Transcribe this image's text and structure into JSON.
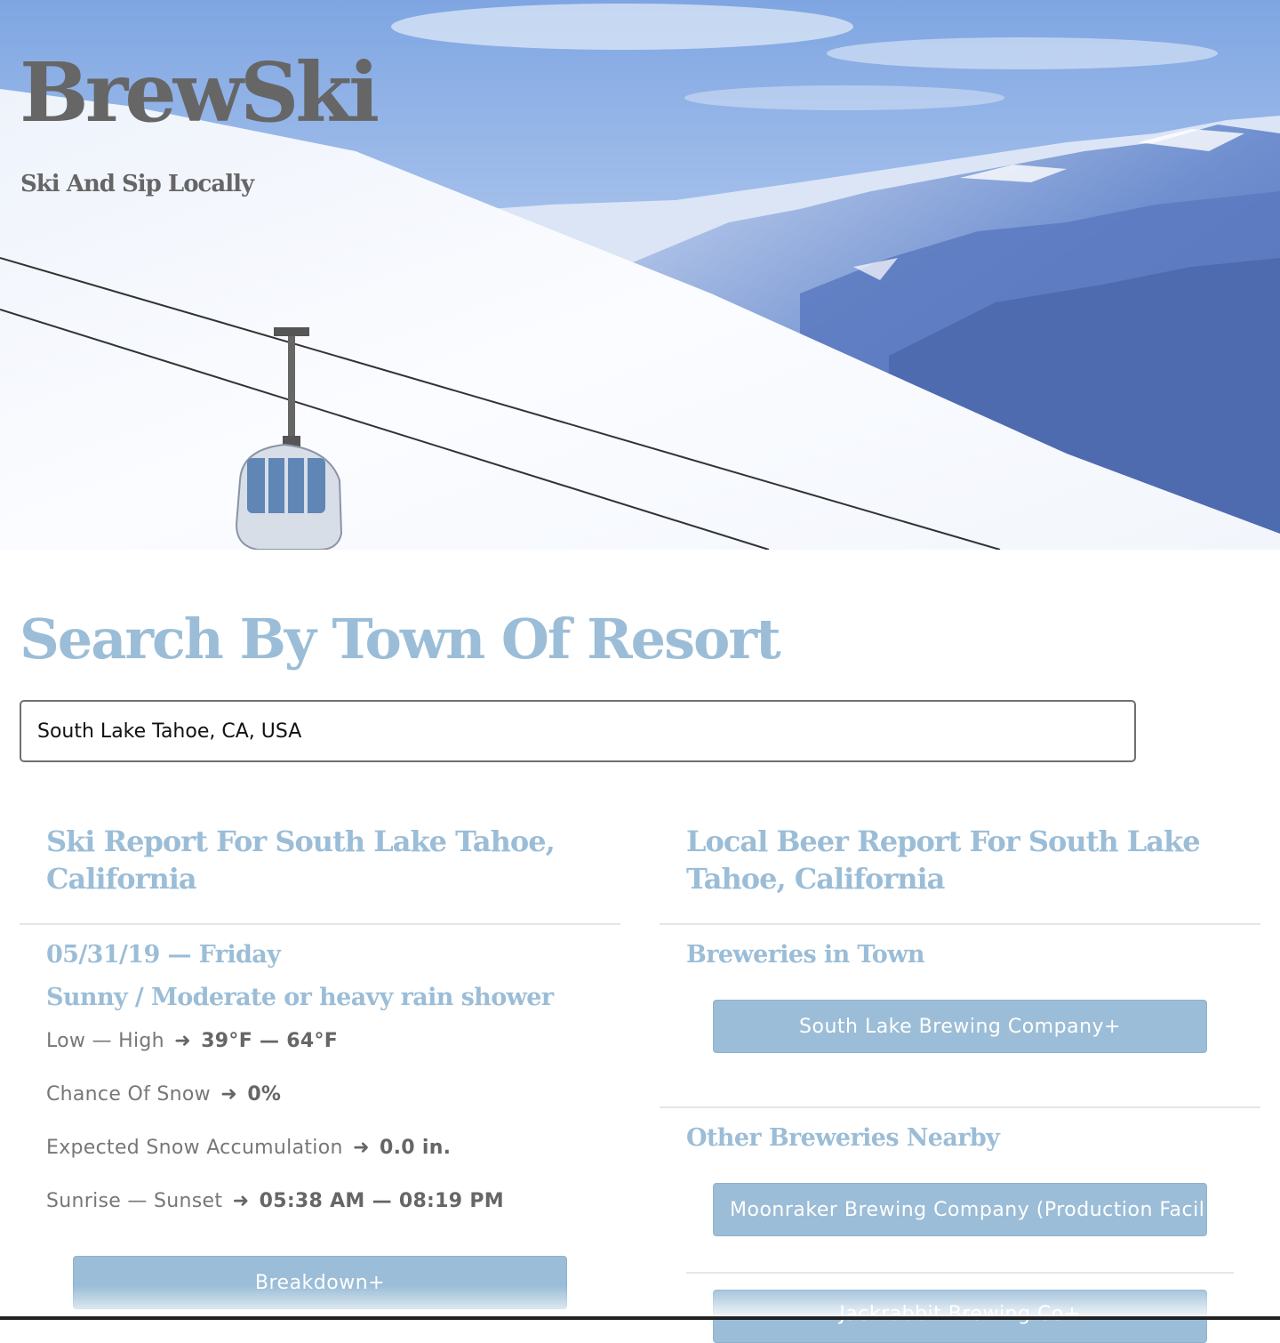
{
  "brand": {
    "name": "BrewSki",
    "tagline": "Ski And Sip Locally"
  },
  "search": {
    "title": "Search By Town Of Resort",
    "value": "South Lake Tahoe, CA, USA"
  },
  "ski_report": {
    "title": "Ski Report For South Lake Tahoe, California",
    "date": "05/31/19 — Friday",
    "conditions": "Sunny / Moderate or heavy rain shower",
    "temp_label": "Low — High",
    "temp_value": "39°F — 64°F",
    "snow_chance_label": "Chance Of Snow",
    "snow_chance_value": "0%",
    "accumulation_label": "Expected Snow Accumulation",
    "accumulation_value": "0.0 in.",
    "sun_label": "Sunrise — Sunset",
    "sun_value": "05:38 AM — 08:19 PM",
    "arrow": "➜",
    "breakdown_label": "Breakdown+"
  },
  "beer_report": {
    "title": "Local Beer Report For South Lake Tahoe, California",
    "in_town_title": "Breweries in Town",
    "in_town": [
      "South Lake Brewing Company+"
    ],
    "nearby_title": "Other Breweries Nearby",
    "nearby": [
      "Moonraker Brewing Company (Production Facility",
      "Jackrabbit Brewing Co+"
    ]
  },
  "colors": {
    "accent": "#9bbdd7",
    "text": "#666666",
    "muted": "#777777"
  }
}
